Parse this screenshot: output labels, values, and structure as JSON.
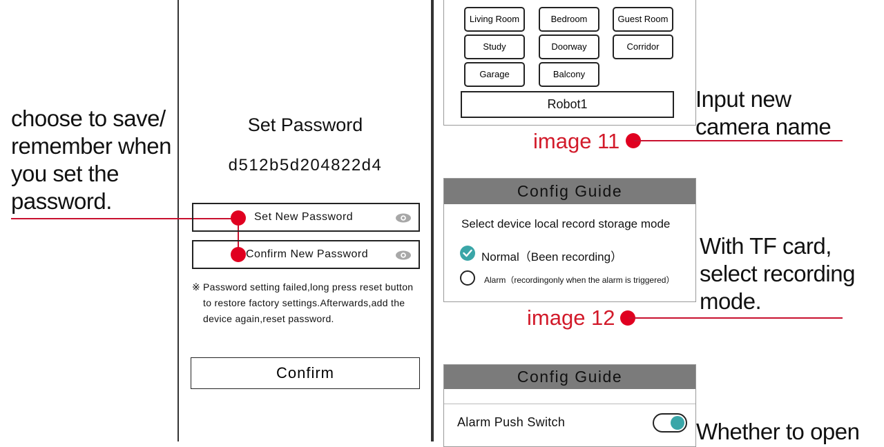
{
  "annotations": {
    "save_remember": [
      "choose to save/",
      "remember when",
      "you set the",
      "password."
    ],
    "camera_name": [
      "Input new",
      "camera name"
    ],
    "tf_card": [
      "With TF card,",
      "select recording",
      "mode."
    ],
    "alarm_push": "Whether to open"
  },
  "captions": {
    "image11": "image 11",
    "image12": "image 12"
  },
  "set_password": {
    "title": "Set Password",
    "device_id": "d512b5d204822d4",
    "new_password_placeholder": "Set New Password",
    "confirm_password_placeholder": "Confirm New Password",
    "note_mark": "※",
    "note_lines": [
      "Password setting failed,long press reset button",
      "to restore factory settings.Afterwards,add the",
      "device again,reset password."
    ],
    "confirm_label": "Confirm"
  },
  "rooms": {
    "items": [
      "Living Room",
      "Bedroom",
      "Guest Room",
      "Study",
      "Doorway",
      "Corridor",
      "Garage",
      "Balcony"
    ],
    "camera_name_value": "Robot1"
  },
  "record_guide": {
    "header": "Config Guide",
    "prompt": "Select device local record storage mode",
    "normal_label": "Normal（Been recording）",
    "alarm_label": "Alarm（recordingonly when the alarm is triggered）",
    "selected": "normal"
  },
  "push_guide": {
    "header": "Config Guide",
    "switch_label": "Alarm Push Switch",
    "switch_on": true
  },
  "colors": {
    "accent_red": "#e00020",
    "toggle_teal": "#3aa6a8",
    "header_gray": "#7b7b7b"
  },
  "icons": [
    "eye-icon",
    "check-icon"
  ]
}
